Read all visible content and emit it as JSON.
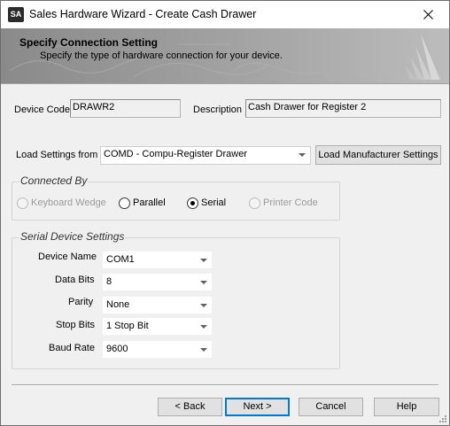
{
  "window": {
    "app_icon_text": "SA",
    "title": "Sales Hardware Wizard - Create Cash Drawer"
  },
  "banner": {
    "heading": "Specify Connection Setting",
    "subtitle": "Specify the type of hardware connection for your device."
  },
  "device": {
    "code_label": "Device Code",
    "code_value": "DRAWR2",
    "description_label": "Description",
    "description_value": "Cash Drawer for Register 2"
  },
  "load_settings": {
    "label": "Load Settings from",
    "value": "COMD - Compu-Register Drawer",
    "button_label": "Load Manufacturer Settings"
  },
  "connected_by": {
    "title": "Connected By",
    "options": [
      {
        "label": "Keyboard Wedge",
        "selected": false,
        "enabled": false
      },
      {
        "label": "Parallel",
        "selected": false,
        "enabled": true
      },
      {
        "label": "Serial",
        "selected": true,
        "enabled": true
      },
      {
        "label": "Printer Code",
        "selected": false,
        "enabled": false
      }
    ]
  },
  "serial_settings": {
    "title": "Serial Device Settings",
    "fields": [
      {
        "label": "Device Name",
        "value": "COM1"
      },
      {
        "label": "Data Bits",
        "value": "8"
      },
      {
        "label": "Parity",
        "value": "None"
      },
      {
        "label": "Stop Bits",
        "value": "1 Stop Bit"
      },
      {
        "label": "Baud Rate",
        "value": "9600"
      }
    ]
  },
  "footer": {
    "back_label": "< Back",
    "next_label": "Next >",
    "cancel_label": "Cancel",
    "help_label": "Help"
  },
  "colors": {
    "accent": "#0078d7",
    "banner": "#8f8f8f",
    "dialog_bg": "#f0f0f0"
  }
}
